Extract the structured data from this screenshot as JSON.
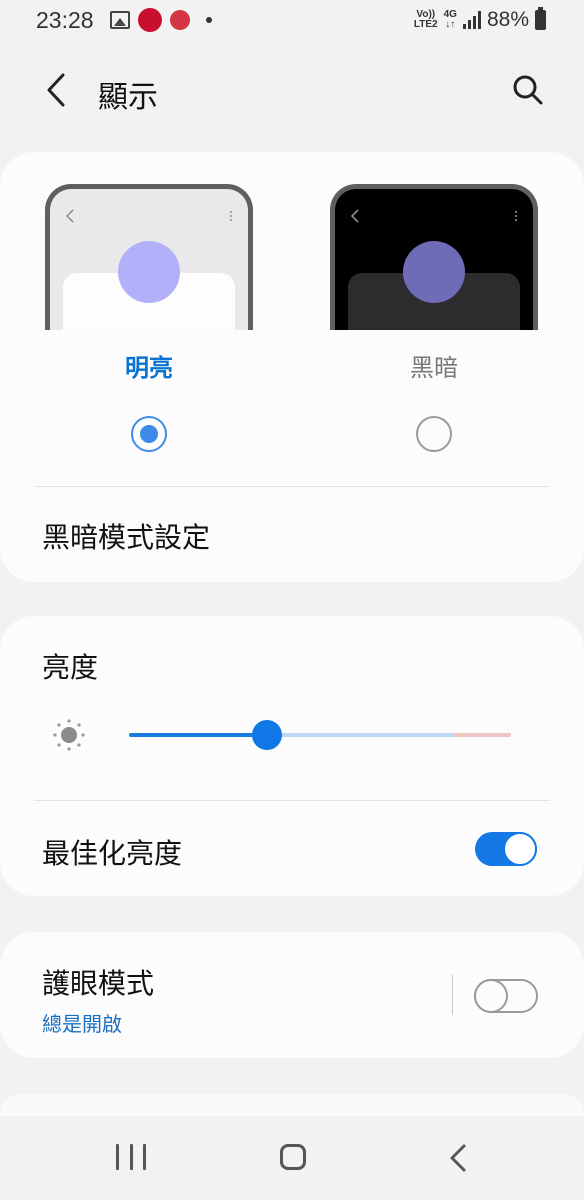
{
  "status_bar": {
    "time": "23:28",
    "volte_line1": "Vo))",
    "volte_line2": "LTE2",
    "network_top": "4G",
    "network_bottom": "↓↑",
    "battery_percent": "88%",
    "icons": [
      "gallery-icon",
      "antutu-icon",
      "antutu-icon",
      "notification-dot-icon",
      "volte-icon",
      "4g-icon",
      "signal-icon",
      "battery-icon"
    ]
  },
  "header": {
    "title": "顯示",
    "back_icon": "chevron-left-icon",
    "search_icon": "search-icon"
  },
  "theme": {
    "options": [
      {
        "label": "明亮",
        "selected": true
      },
      {
        "label": "黑暗",
        "selected": false
      }
    ],
    "dark_mode_settings": "黑暗模式設定",
    "colors": {
      "accent": "#0a73cf",
      "light_preview_circle": "#b3b0fa",
      "dark_preview_circle": "#6e6cb7"
    }
  },
  "brightness": {
    "title": "亮度",
    "level": 0.36,
    "adaptive_label": "最佳化亮度",
    "adaptive_on": true
  },
  "eye_comfort": {
    "title": "護眼模式",
    "subtitle": "總是開啟",
    "enabled": false
  },
  "nav_bar": {
    "icons": [
      "recent-apps-icon",
      "home-icon",
      "back-icon"
    ]
  }
}
